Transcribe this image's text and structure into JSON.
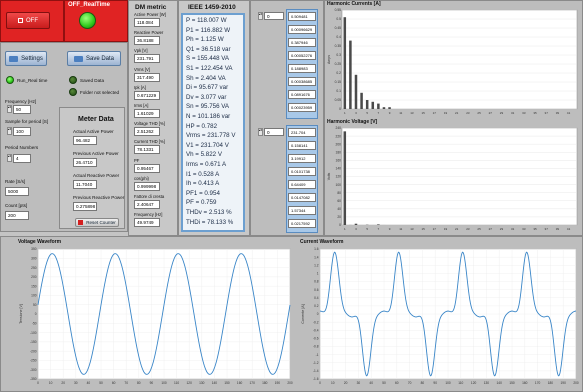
{
  "controls": {
    "off_label": "OFF",
    "realtime_title": "OFF_RealTime",
    "settings_label": "Settings",
    "save_data_label": "Save Data",
    "run_realtime_label": "Run_Real time",
    "saved_data_label": "Saved Data",
    "folder_label": "Folder not selected",
    "frequency_label": "Frequency [Hz]",
    "frequency_value": "50",
    "sample_label": "Sample for period [S]",
    "sample_value": "100",
    "period_label": "Period Numbers",
    "period_value": "4",
    "rate_label": "Rate [S/s]",
    "rate_value": "5000",
    "count_label": "Count [pts]",
    "count_value": "200",
    "reset_label": "Reset Counter"
  },
  "meter": {
    "title": "Meter Data",
    "fields": [
      {
        "label": "Actual Active Power",
        "value": "96.482"
      },
      {
        "label": "Previous Active Power",
        "value": "26.4710"
      },
      {
        "label": "Actual Reactive Power",
        "value": "11.7040"
      },
      {
        "label": "Previous Reactive Power",
        "value": "0.275898"
      }
    ]
  },
  "dm_metric": {
    "title": "DM metric",
    "fields": [
      {
        "label": "Active Power [W]",
        "value": "118.084"
      },
      {
        "label": "Reactive Power",
        "value": "36.8188"
      },
      {
        "label": "Vpk [V]",
        "value": "231.791"
      },
      {
        "label": "Vrms [V]",
        "value": "317.490"
      },
      {
        "label": "Ipk [A]",
        "value": "0.671229"
      },
      {
        "label": "Irms [A]",
        "value": "1.61029"
      },
      {
        "label": "Voltage THD [%]",
        "value": "2.51262"
      },
      {
        "label": "Current THD [%]",
        "value": "78.1331"
      },
      {
        "label": "PF",
        "value": "0.95467"
      },
      {
        "label": "cos(phi)",
        "value": "0.999998"
      },
      {
        "label": "Fattore di cresta",
        "value": "2.40647"
      },
      {
        "label": "Frequency [Hz]",
        "value": "49.9749"
      }
    ]
  },
  "ieee": {
    "title": "IEEE 1459-2010",
    "lines": [
      "P = 118.007 W",
      "P1 = 116.882 W",
      "Ph = 1.125 W",
      "Q1 = 36.518 var",
      "S = 155.448 VA",
      "S1 = 122.454 VA",
      "Sh = 2.404 VA",
      "Di = 95.677 var",
      "Dv = 3.077 var",
      "Sn = 95.756 VA",
      "N = 101.186 var",
      "HP = 0.782",
      "Vrms = 231.778 V",
      "V1 = 231.704 V",
      "Vh = 5.822 V",
      "Irms = 0.671 A",
      "I1 = 0.528 A",
      "Ih = 0.413 A",
      "PF1 = 0.954",
      "PF = 0.759",
      "THDv = 2.513 %",
      "THDi = 78.133 %"
    ]
  },
  "harmonic_current_list": {
    "index": "0",
    "values": [
      "0.509481",
      "0.00096629",
      "0.387946",
      "0.00052276",
      "0.188983",
      "0.00038685",
      "0.0891676",
      "0.00023959"
    ]
  },
  "harmonic_voltage_list": {
    "index": "0",
    "values": [
      "231.704",
      "0.158141",
      "3.19912",
      "0.0101738",
      "0.64409",
      "0.0147082",
      "1.57344",
      "0.0217592"
    ]
  },
  "chart_data": [
    {
      "type": "bar",
      "title": "Harmonic Currents [A]",
      "ylabel": "Amps",
      "ylim": [
        0,
        0.55
      ],
      "yticks": [
        "0",
        "0.05",
        "0.1",
        "0.15",
        "0.2",
        "0.25",
        "0.3",
        "0.35",
        "0.4",
        "0.45",
        "0.5",
        "0.55"
      ],
      "categories": [
        "1",
        "2",
        "3",
        "4",
        "5",
        "6",
        "7",
        "8",
        "9",
        "10",
        "11",
        "12",
        "13",
        "14",
        "15",
        "16",
        "17",
        "18",
        "19",
        "20",
        "21",
        "22",
        "23",
        "24",
        "25",
        "26",
        "27",
        "28",
        "29",
        "30",
        "31",
        "32",
        "33",
        "34",
        "35",
        "36",
        "37",
        "38",
        "39",
        "40",
        "41",
        "42"
      ],
      "values": [
        0.51,
        0.38,
        0.19,
        0.09,
        0.05,
        0.04,
        0.03,
        0.01,
        0.01,
        0,
        0,
        0,
        0,
        0,
        0,
        0,
        0,
        0,
        0,
        0,
        0,
        0,
        0,
        0,
        0,
        0,
        0,
        0,
        0,
        0,
        0,
        0,
        0,
        0,
        0,
        0,
        0,
        0,
        0,
        0,
        0,
        0
      ],
      "color": "#4a4a4a"
    },
    {
      "type": "bar",
      "title": "Harmonic Voltage [V]",
      "ylabel": "Volts",
      "ylim": [
        0,
        240
      ],
      "yticks": [
        "0",
        "20",
        "40",
        "60",
        "80",
        "100",
        "120",
        "140",
        "160",
        "180",
        "200",
        "220",
        "240"
      ],
      "categories": [
        "1",
        "2",
        "3",
        "4",
        "5",
        "6",
        "7",
        "8",
        "9",
        "10",
        "11",
        "12",
        "13",
        "14",
        "15",
        "16",
        "17",
        "18",
        "19",
        "20",
        "21",
        "22",
        "23",
        "24",
        "25",
        "26",
        "27",
        "28",
        "29",
        "30",
        "31",
        "32",
        "33",
        "34",
        "35",
        "36",
        "37",
        "38",
        "39",
        "40",
        "41",
        "42"
      ],
      "values": [
        231.7,
        0.16,
        3.2,
        0.01,
        0.64,
        0.01,
        1.57,
        0.02,
        0,
        0,
        0,
        0,
        0,
        0,
        0,
        0,
        0,
        0,
        0,
        0,
        0,
        0,
        0,
        0,
        0,
        0,
        0,
        0,
        0,
        0,
        0,
        0,
        0,
        0,
        0,
        0,
        0,
        0,
        0,
        0,
        0,
        0
      ],
      "color": "#4a4a4a"
    },
    {
      "type": "line",
      "title": "Voltage Waveform",
      "ylabel": "Tensione [V]",
      "ylim": [
        -350,
        350
      ],
      "yticks": [
        "-350",
        "-300",
        "-250",
        "-200",
        "-150",
        "-100",
        "-50",
        "0",
        "50",
        "100",
        "150",
        "200",
        "250",
        "300",
        "350"
      ],
      "xticks": [
        "0",
        "10",
        "20",
        "30",
        "40",
        "50",
        "60",
        "70",
        "80",
        "90",
        "100",
        "110",
        "120",
        "130",
        "140",
        "150",
        "160",
        "170",
        "180",
        "190",
        "200"
      ],
      "x_range": [
        0,
        200
      ],
      "waveform": "sine",
      "amplitude": 325,
      "periods": 4,
      "color": "#3a86c8"
    },
    {
      "type": "line",
      "title": "Current Waveform",
      "ylabel": "Corrente [A]",
      "ylim": [
        -1.6,
        1.6
      ],
      "yticks": [
        "-1.6",
        "-1.4",
        "-1.2",
        "-1",
        "-0.8",
        "-0.6",
        "-0.4",
        "-0.2",
        "0",
        "0.2",
        "0.4",
        "0.6",
        "0.8",
        "1",
        "1.2",
        "1.4",
        "1.6"
      ],
      "xticks": [
        "0",
        "10",
        "20",
        "30",
        "40",
        "50",
        "60",
        "70",
        "80",
        "90",
        "100",
        "110",
        "120",
        "130",
        "140",
        "150",
        "160",
        "170",
        "180",
        "190",
        "200"
      ],
      "x_range": [
        0,
        200
      ],
      "waveform": "pulsed",
      "amplitude": 1.55,
      "periods": 4,
      "color": "#3a86c8"
    }
  ]
}
